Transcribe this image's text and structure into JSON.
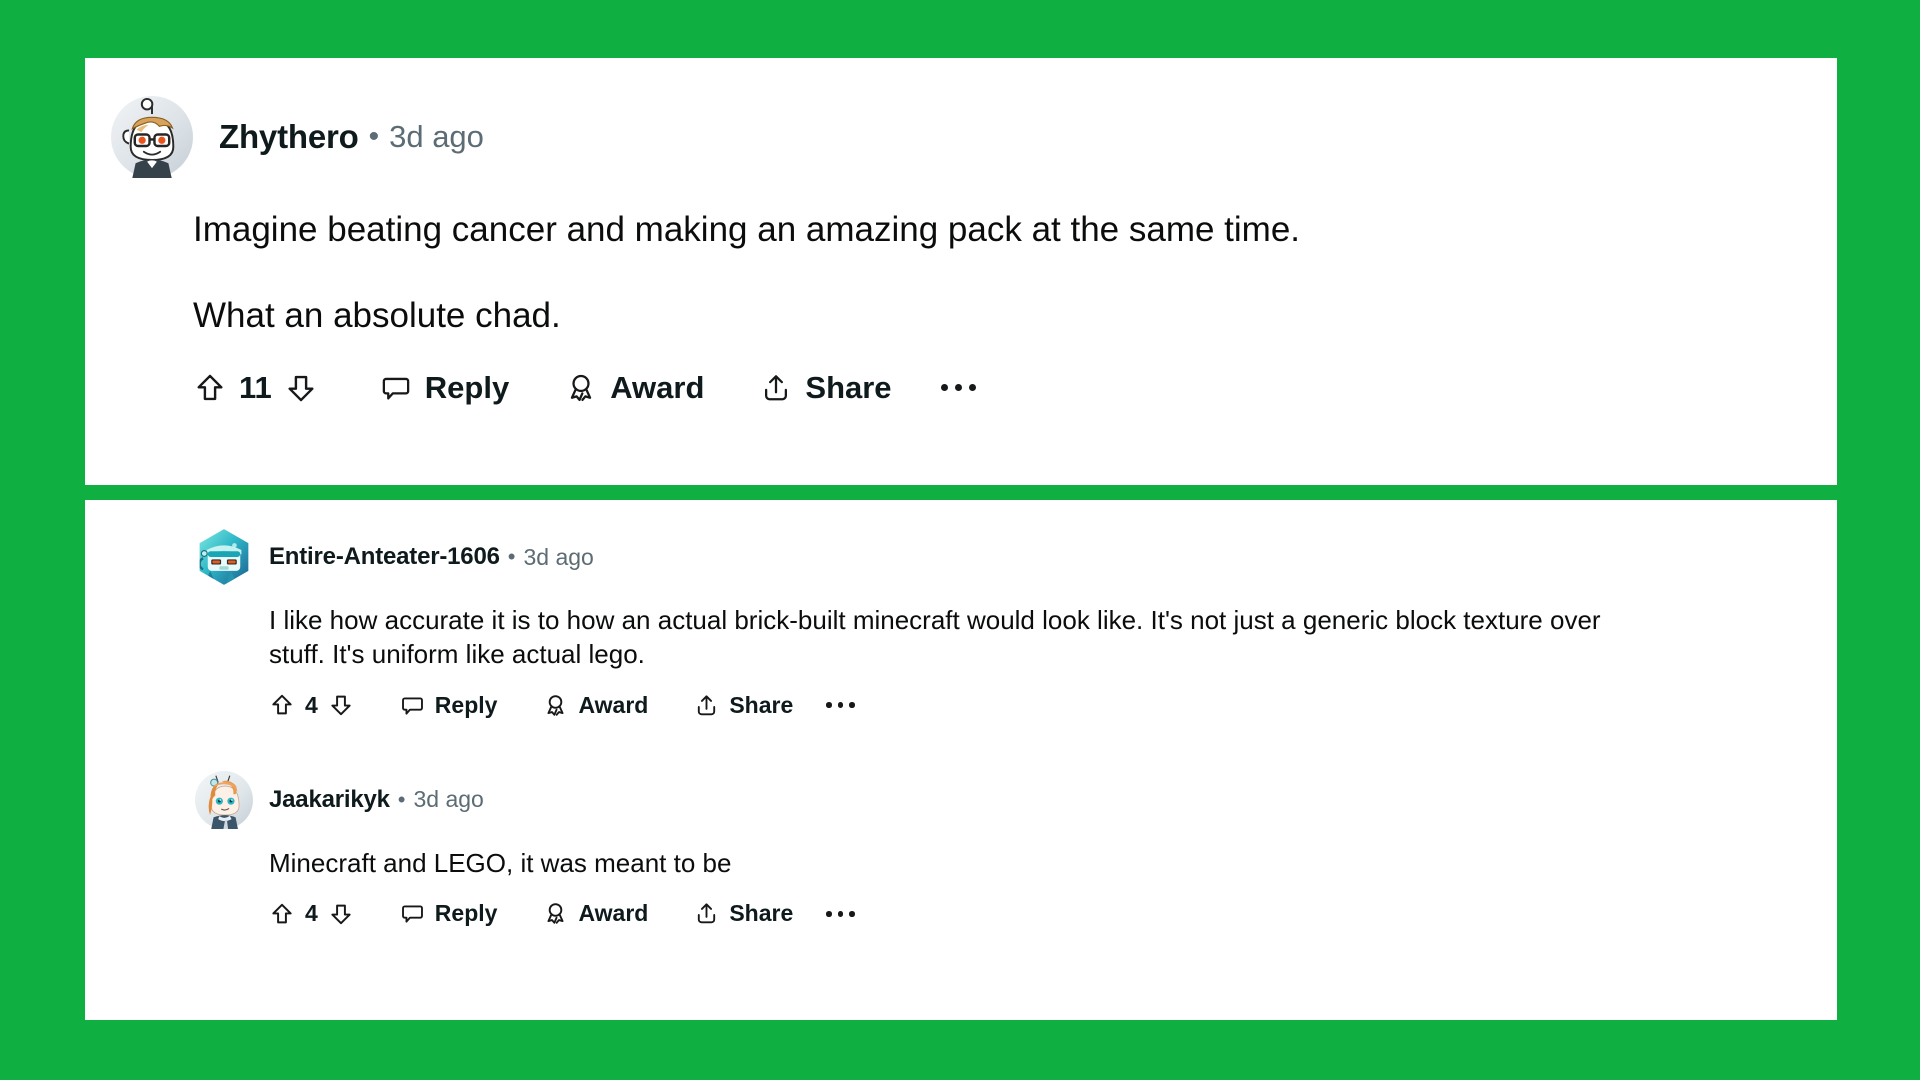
{
  "theme": {
    "background_color": "#0FAF41",
    "card_color": "#FFFFFF",
    "text_color": "#0B0C0C",
    "meta_color": "#5C6C74"
  },
  "comments": [
    {
      "id": "root",
      "author": "Zhythero",
      "separator": "•",
      "timestamp": "3d ago",
      "avatar": "snoo-blonde-glasses-avatar",
      "paragraphs": [
        "Imagine beating cancer and making an amazing pack at the same time.",
        "What an absolute chad."
      ],
      "actions": {
        "upvote_icon": "upvote-arrow-icon",
        "vote_count": "11",
        "downvote_icon": "downvote-arrow-icon",
        "reply_icon": "speech-bubble-icon",
        "reply_label": "Reply",
        "award_icon": "award-medal-icon",
        "award_label": "Award",
        "share_icon": "share-upload-icon",
        "share_label": "Share",
        "more_icon": "more-options-ellipsis-icon"
      }
    },
    {
      "id": "reply-1",
      "author": "Entire-Anteater-1606",
      "separator": "•",
      "timestamp": "3d ago",
      "avatar": "hexagon-nft-robot-avatar",
      "paragraphs": [
        "I like how accurate it is to how an actual brick-built minecraft would look like. It's not just a generic block texture over stuff. It's uniform like actual lego."
      ],
      "actions": {
        "upvote_icon": "upvote-arrow-icon",
        "vote_count": "4",
        "downvote_icon": "downvote-arrow-icon",
        "reply_icon": "speech-bubble-icon",
        "reply_label": "Reply",
        "award_icon": "award-medal-icon",
        "award_label": "Award",
        "share_icon": "share-upload-icon",
        "share_label": "Share",
        "more_icon": "more-options-ellipsis-icon"
      }
    },
    {
      "id": "reply-2",
      "author": "Jaakarikyk",
      "separator": "•",
      "timestamp": "3d ago",
      "avatar": "snoo-orange-hair-avatar",
      "paragraphs": [
        "Minecraft and LEGO, it was meant to be"
      ],
      "actions": {
        "upvote_icon": "upvote-arrow-icon",
        "vote_count": "4",
        "downvote_icon": "downvote-arrow-icon",
        "reply_icon": "speech-bubble-icon",
        "reply_label": "Reply",
        "award_icon": "award-medal-icon",
        "award_label": "Award",
        "share_icon": "share-upload-icon",
        "share_label": "Share",
        "more_icon": "more-options-ellipsis-icon"
      }
    }
  ]
}
